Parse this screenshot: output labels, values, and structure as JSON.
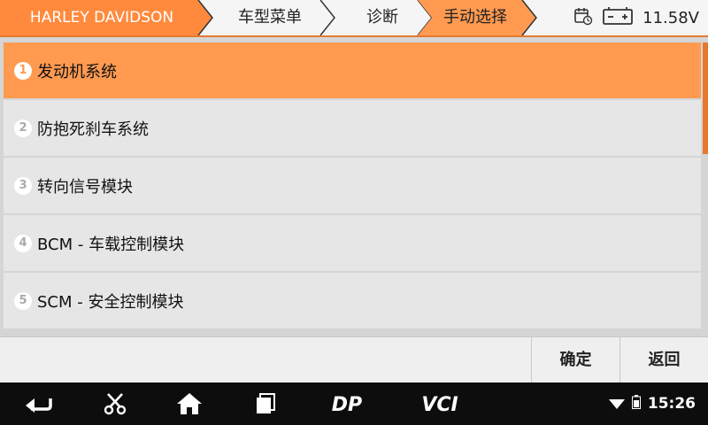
{
  "header": {
    "breadcrumbs": [
      "HARLEY DAVIDSON",
      "车型菜单",
      "诊断",
      "手动选择"
    ],
    "voltage": "11.58V",
    "icons": [
      "calendar-clock-icon",
      "battery-icon"
    ]
  },
  "colors": {
    "accent": "#ff9a50",
    "accent_dark": "#e57a2f",
    "row_bg": "#e6e6e6",
    "nav_bg": "#0d0d0d"
  },
  "menu": {
    "items": [
      {
        "num": "1",
        "label": "发动机系统",
        "selected": true
      },
      {
        "num": "2",
        "label": "防抱死刹车系统",
        "selected": false
      },
      {
        "num": "3",
        "label": "转向信号模块",
        "selected": false
      },
      {
        "num": "4",
        "label": "BCM - 车载控制模块",
        "selected": false
      },
      {
        "num": "5",
        "label": "SCM - 安全控制模块",
        "selected": false
      }
    ]
  },
  "actions": {
    "ok_label": "确定",
    "back_label": "返回"
  },
  "navbar": {
    "icons": [
      "back-icon",
      "scissors-icon",
      "home-icon",
      "recent-apps-icon",
      "dp-icon",
      "vci-icon"
    ],
    "dp_label": "DP",
    "vci_label": "VCI",
    "time": "15:26"
  }
}
